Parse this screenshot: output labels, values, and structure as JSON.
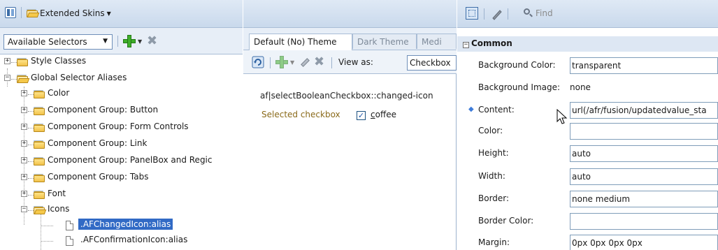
{
  "left": {
    "toolbar": {
      "skins_label": "Extended Skins"
    },
    "selector_dropdown": "Available Selectors",
    "tree": [
      {
        "label": "Style Classes",
        "level": 0,
        "type": "folder",
        "expanded": false
      },
      {
        "label": "Global Selector Aliases",
        "level": 0,
        "type": "folder",
        "expanded": true
      },
      {
        "label": "Color",
        "level": 1,
        "type": "folder",
        "expanded": false
      },
      {
        "label": "Component Group: Button",
        "level": 1,
        "type": "folder",
        "expanded": false
      },
      {
        "label": "Component Group: Form Controls",
        "level": 1,
        "type": "folder",
        "expanded": false
      },
      {
        "label": "Component Group: Link",
        "level": 1,
        "type": "folder",
        "expanded": false
      },
      {
        "label": "Component Group: PanelBox and Regic",
        "level": 1,
        "type": "folder",
        "expanded": false
      },
      {
        "label": "Component Group: Tabs",
        "level": 1,
        "type": "folder",
        "expanded": false
      },
      {
        "label": "Font",
        "level": 1,
        "type": "folder",
        "expanded": false
      },
      {
        "label": "Icons",
        "level": 1,
        "type": "folder",
        "expanded": true
      },
      {
        "label": ".AFChangedIcon:alias",
        "level": 2,
        "type": "doc",
        "selected": true
      },
      {
        "label": ".AFConfirmationIcon:alias",
        "level": 2,
        "type": "doc"
      }
    ]
  },
  "middle": {
    "tabs": [
      {
        "label": "Default (No) Theme",
        "active": true
      },
      {
        "label": "Dark Theme",
        "active": false
      },
      {
        "label": "Medi",
        "active": false
      }
    ],
    "view_as_label": "View as:",
    "view_as_value": "Checkbox",
    "preview_selector": "af|selectBooleanCheckbox::changed-icon",
    "preview_label": "Selected checkbox",
    "preview_checkbox_text_first": "c",
    "preview_checkbox_text_rest": "offee",
    "checkbox_mark": "✓"
  },
  "right": {
    "find_placeholder": "Find",
    "section": "Common",
    "properties": [
      {
        "label": "Background Color:",
        "value": "transparent",
        "boxed": true
      },
      {
        "label": "Background Image:",
        "value": "none",
        "boxed": false
      },
      {
        "label": "Content:",
        "value": "url(/afr/fusion/updatedvalue_sta",
        "boxed": true,
        "modified": true
      },
      {
        "label": "Color:",
        "value": "",
        "boxed": true
      },
      {
        "label": "Height:",
        "value": "auto",
        "boxed": true
      },
      {
        "label": "Width:",
        "value": "auto",
        "boxed": true
      },
      {
        "label": "Border:",
        "value": "none medium",
        "boxed": true
      },
      {
        "label": "Border Color:",
        "value": "",
        "boxed": true
      },
      {
        "label": "Margin:",
        "value": "0px 0px 0px 0px",
        "boxed": true
      }
    ]
  },
  "colors": {
    "selection": "#316ac5",
    "toolbar_gradient_top": "#dfe9f5",
    "accent_green": "#3fae2a",
    "preview_label_color": "#8a6a1a"
  }
}
